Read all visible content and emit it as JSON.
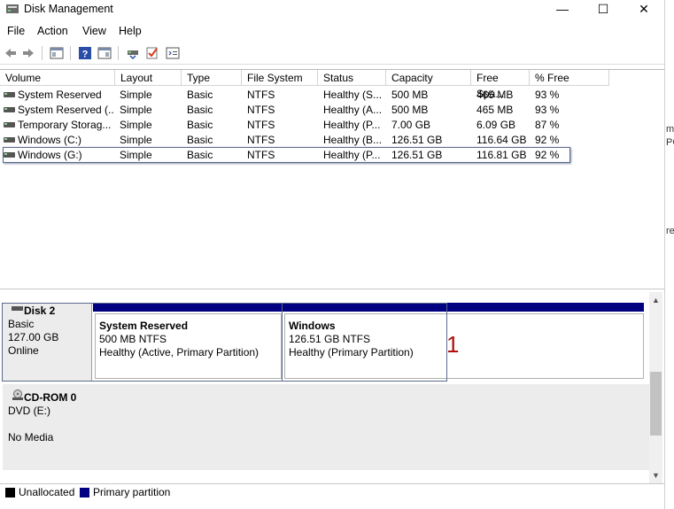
{
  "window": {
    "title": "Disk Management",
    "minimize": "—",
    "maximize": "☐",
    "close": "✕"
  },
  "menu": [
    "File",
    "Action",
    "View",
    "Help"
  ],
  "toolbar": {
    "icons": [
      "back-arrow-icon",
      "forward-arrow-icon",
      "console-tree-icon",
      "help-icon",
      "properties-icon",
      "connect-disk-icon",
      "checkmark-icon",
      "settings-list-icon"
    ]
  },
  "columns": [
    "Volume",
    "Layout",
    "Type",
    "File System",
    "Status",
    "Capacity",
    "Free Spa...",
    "% Free"
  ],
  "volumes": [
    {
      "volume": "System Reserved",
      "layout": "Simple",
      "type": "Basic",
      "fs": "NTFS",
      "status": "Healthy (S...",
      "capacity": "500 MB",
      "free": "465 MB",
      "pct": "93 %"
    },
    {
      "volume": "System Reserved (...",
      "layout": "Simple",
      "type": "Basic",
      "fs": "NTFS",
      "status": "Healthy (A...",
      "capacity": "500 MB",
      "free": "465 MB",
      "pct": "93 %"
    },
    {
      "volume": "Temporary Storag...",
      "layout": "Simple",
      "type": "Basic",
      "fs": "NTFS",
      "status": "Healthy (P...",
      "capacity": "7.00 GB",
      "free": "6.09 GB",
      "pct": "87 %"
    },
    {
      "volume": "Windows (C:)",
      "layout": "Simple",
      "type": "Basic",
      "fs": "NTFS",
      "status": "Healthy (B...",
      "capacity": "126.51 GB",
      "free": "116.64 GB",
      "pct": "92 %"
    },
    {
      "volume": "Windows (G:)",
      "layout": "Simple",
      "type": "Basic",
      "fs": "NTFS",
      "status": "Healthy (P...",
      "capacity": "126.51 GB",
      "free": "116.81 GB",
      "pct": "92 %"
    }
  ],
  "disks": [
    {
      "name": "Disk 2",
      "type": "Basic",
      "size": "127.00 GB",
      "state": "Online",
      "partitions": [
        {
          "name": "System Reserved",
          "size": "500 MB NTFS",
          "status": "Healthy (Active, Primary Partition)"
        },
        {
          "name": "Windows",
          "size": "126.51 GB NTFS",
          "status": "Healthy (Primary Partition)"
        }
      ]
    },
    {
      "name": "CD-ROM 0",
      "type": "DVD (E:)",
      "state": "No Media"
    }
  ],
  "annotation": "1",
  "legend": [
    {
      "label": "Unallocated",
      "color": "#000000"
    },
    {
      "label": "Primary partition",
      "color": "#000080"
    }
  ],
  "side_fragments": [
    "m",
    "PC",
    "re"
  ]
}
